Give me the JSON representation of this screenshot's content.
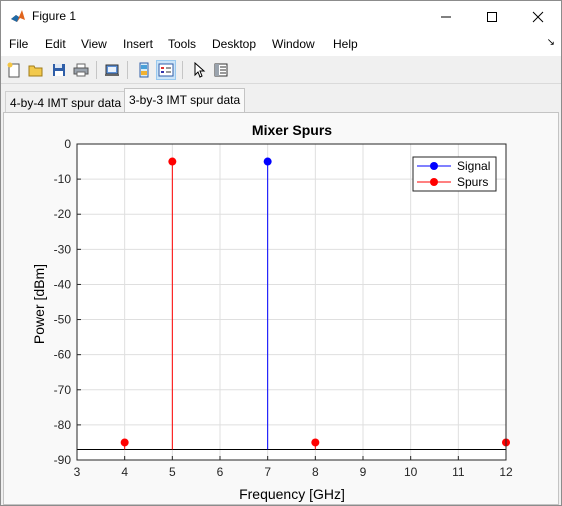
{
  "window": {
    "title": "Figure 1"
  },
  "menu": [
    "File",
    "Edit",
    "View",
    "Insert",
    "Tools",
    "Desktop",
    "Window",
    "Help"
  ],
  "toolbar_icons": [
    "new-figure-icon",
    "open-file-icon",
    "save-icon",
    "print-icon",
    "print-preview-icon",
    "link-plot-icon",
    "insert-legend-icon",
    "pointer-icon",
    "property-inspector-icon"
  ],
  "tabs": [
    {
      "label": "4-by-4 IMT spur data",
      "selected": false
    },
    {
      "label": "3-by-3 IMT spur data",
      "selected": true
    }
  ],
  "colors": {
    "signal": "#0000ff",
    "spurs": "#ff0000",
    "baseline": "#000000"
  },
  "chart_data": {
    "type": "stem",
    "title": "Mixer Spurs",
    "xlabel": "Frequency [GHz]",
    "ylabel": "Power [dBm]",
    "xlim": [
      3,
      12
    ],
    "ylim": [
      -90,
      0
    ],
    "xticks": [
      3,
      4,
      5,
      6,
      7,
      8,
      9,
      10,
      11,
      12
    ],
    "yticks": [
      0,
      -10,
      -20,
      -30,
      -40,
      -50,
      -60,
      -70,
      -80,
      -90
    ],
    "baseline": -87,
    "grid": true,
    "legend_position": "top-right",
    "series": [
      {
        "name": "Signal",
        "color": "#0000ff",
        "points": [
          {
            "x": 7,
            "y": -5
          }
        ]
      },
      {
        "name": "Spurs",
        "color": "#ff0000",
        "points": [
          {
            "x": 4,
            "y": -85
          },
          {
            "x": 5,
            "y": -5
          },
          {
            "x": 8,
            "y": -85
          },
          {
            "x": 12,
            "y": -85
          }
        ]
      }
    ]
  }
}
